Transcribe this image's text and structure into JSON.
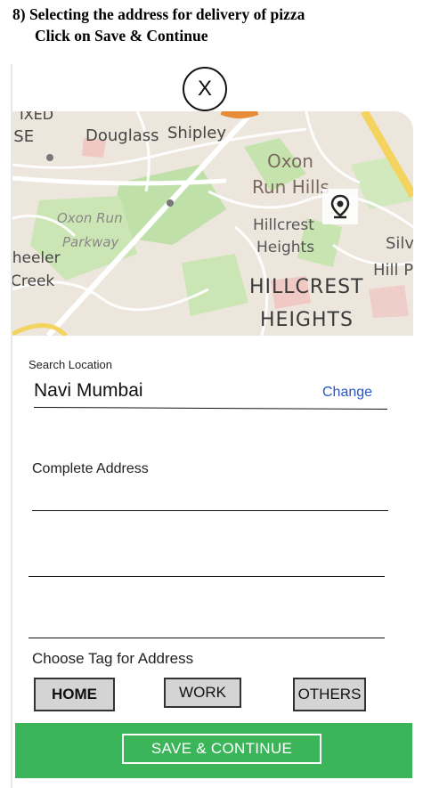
{
  "caption": {
    "line1": "8) Selecting the address for delivery of pizza",
    "line2": "Click on Save & Continue"
  },
  "close_button": {
    "label": "X"
  },
  "map": {
    "labels": {
      "ixed": "IXED",
      "se": "JSE",
      "douglass": "Douglass",
      "shipley": "Shipley",
      "oxon": "Oxon",
      "run_hills": "Run Hills",
      "hillcrest": "Hillcrest",
      "heights": "Heights",
      "oxon_run": "Oxon Run",
      "parkway": "Parkway",
      "wheeler": "/heeler",
      "creek": "Creek",
      "silv": "Silv",
      "hill_p": "Hill P",
      "hillcrest_big": "HILLCREST",
      "heights_big": "HEIGHTS"
    },
    "colors": {
      "land": "#ece6dc",
      "park": "#bfe0a9",
      "road": "#ffffff",
      "highway": "#f4d35e"
    }
  },
  "form": {
    "search_label": "Search Location",
    "search_value": "Navi Mumbai",
    "change_label": "Change",
    "complete_address_label": "Complete Address",
    "tag_label": "Choose Tag for Address",
    "tags": [
      "HOME",
      "WORK",
      "OTHERS"
    ],
    "selected_tag": "HOME"
  },
  "footer": {
    "save_label": "SAVE & CONTINUE",
    "color": "#3cb55a"
  }
}
